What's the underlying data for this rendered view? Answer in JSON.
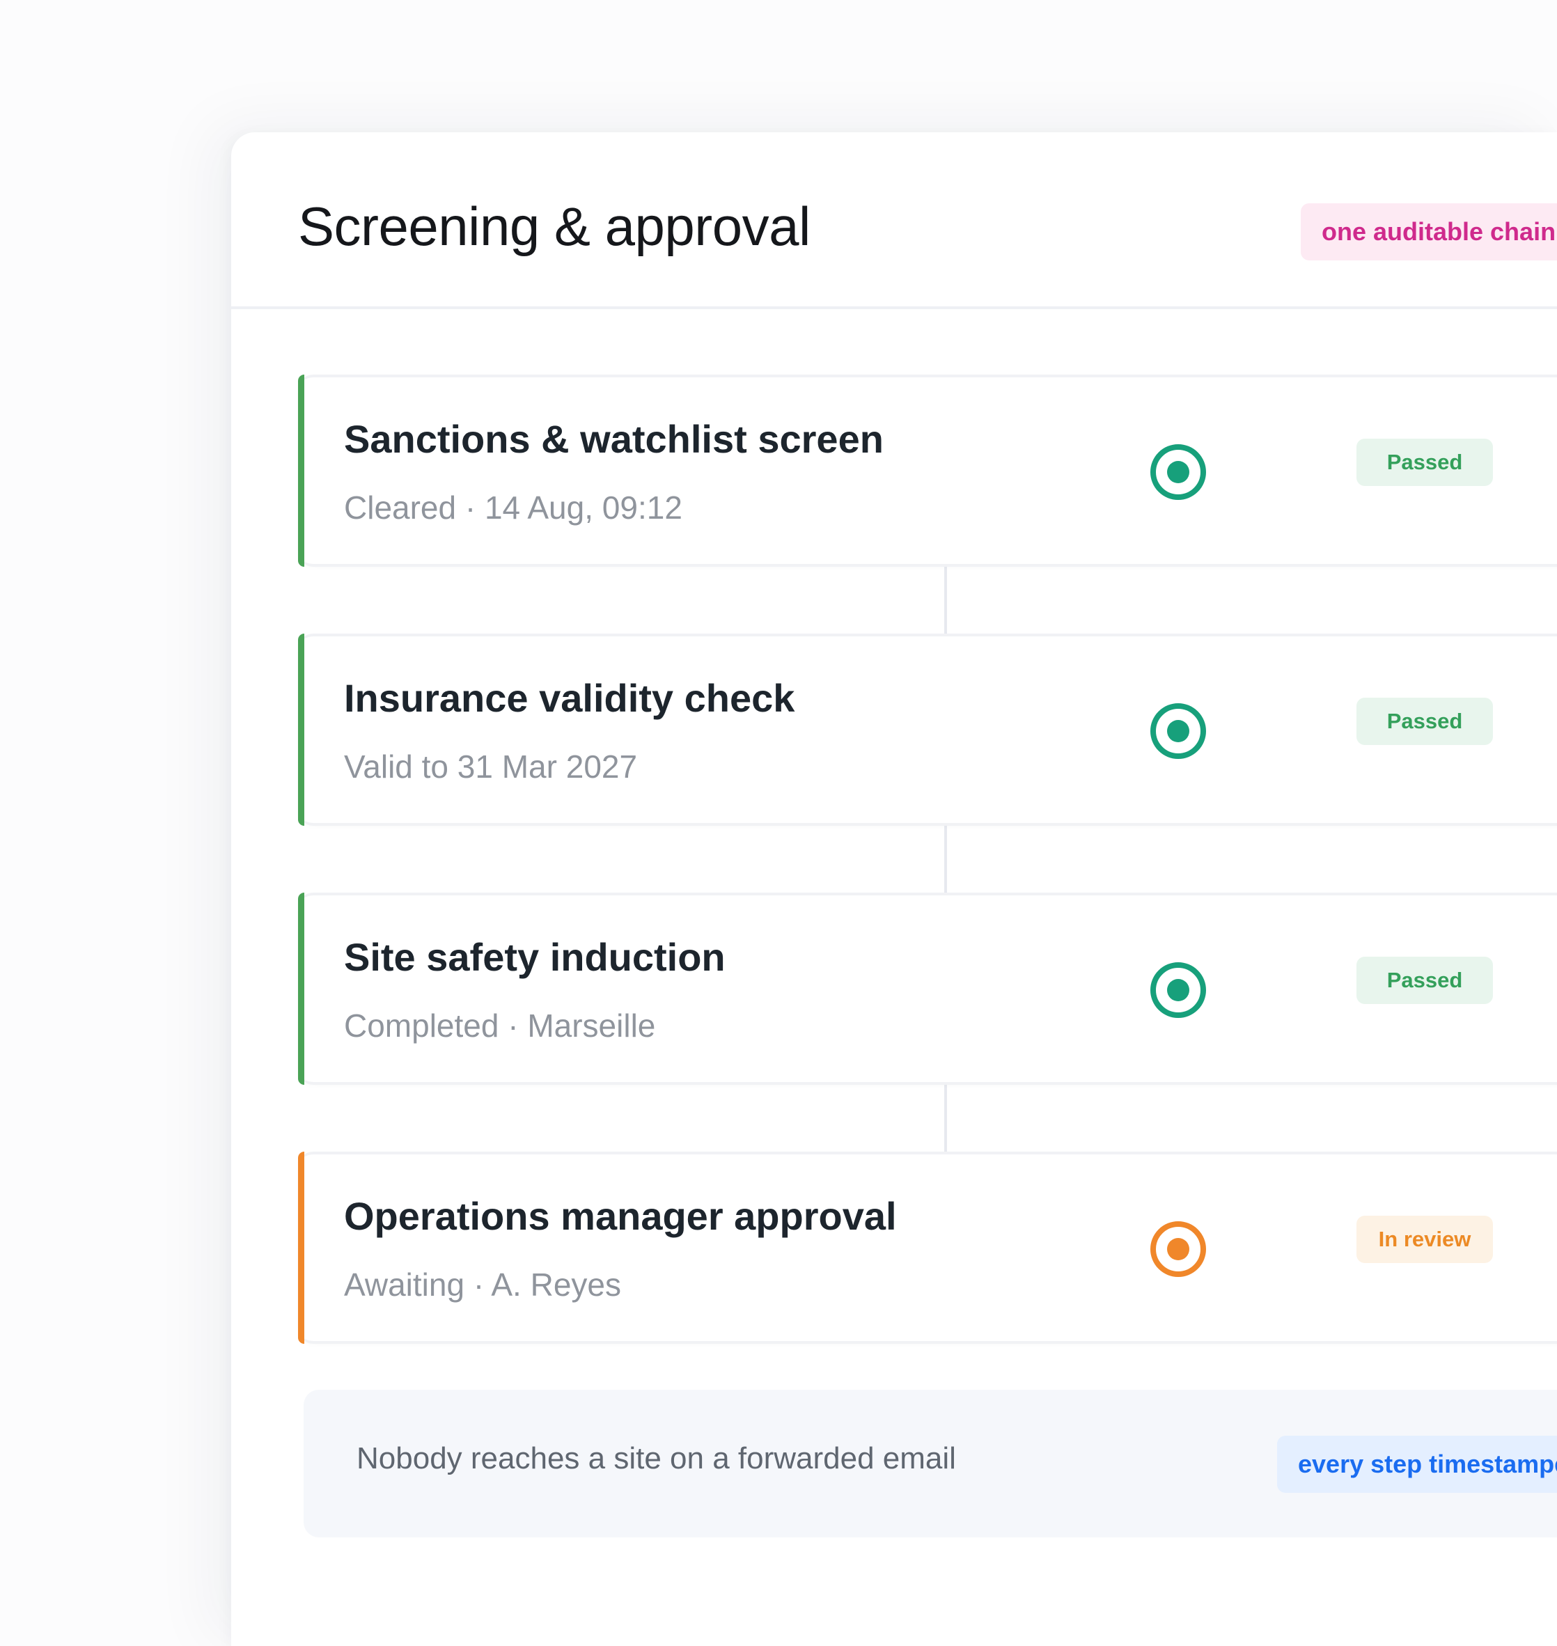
{
  "header": {
    "title": "Screening & approval",
    "chip_label": "one auditable chain"
  },
  "steps": [
    {
      "title": "Sanctions & watchlist screen",
      "subtitle": "Cleared · 14 Aug, 09:12",
      "status": "Passed"
    },
    {
      "title": "Insurance validity check",
      "subtitle": "Valid to 31 Mar 2027",
      "status": "Passed"
    },
    {
      "title": "Site safety induction",
      "subtitle": "Completed · Marseille",
      "status": "Passed"
    },
    {
      "title": "Operations manager approval",
      "subtitle": "Awaiting · A. Reyes",
      "status": "In review"
    }
  ],
  "footer": {
    "text": "Nobody reaches a site on a forwarded email",
    "chip_label": "every step timestamped"
  },
  "colors": {
    "passed_bar": "#4aa356",
    "passed_marker": "#17a07b",
    "review": "#f0872a",
    "pink_chip": "#cf2a8c",
    "blue_chip": "#1a6cf0"
  }
}
